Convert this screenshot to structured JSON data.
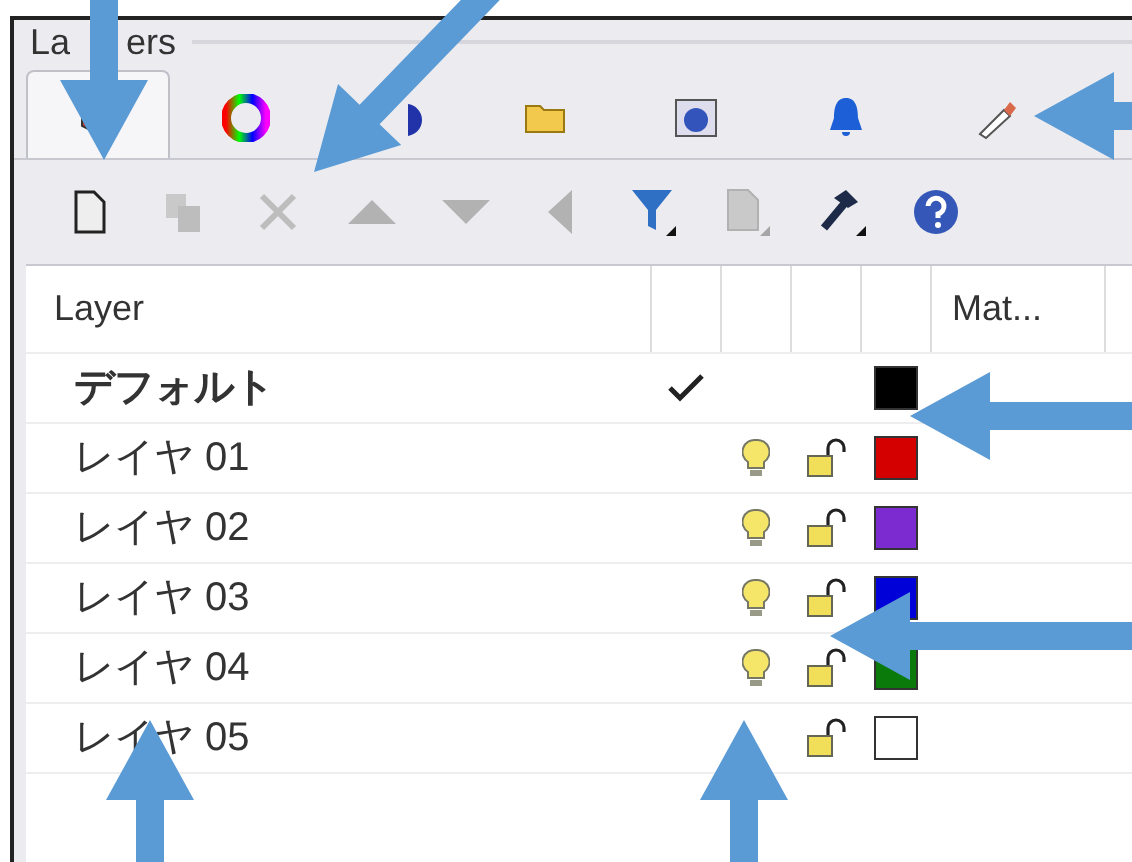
{
  "panel": {
    "title_parts": [
      "La",
      "ers"
    ]
  },
  "tabs": [
    {
      "selected": true
    },
    {
      "selected": false
    },
    {
      "selected": false
    },
    {
      "selected": false
    },
    {
      "selected": false
    },
    {
      "selected": false
    },
    {
      "selected": false
    }
  ],
  "toolbar": [
    {
      "disabled": false
    },
    {
      "disabled": true
    },
    {
      "disabled": true
    },
    {
      "disabled": true
    },
    {
      "disabled": true
    },
    {
      "disabled": true
    },
    {
      "disabled": false
    },
    {
      "disabled": true
    },
    {
      "disabled": false
    },
    {
      "disabled": false
    }
  ],
  "header": {
    "name_column": "Layer",
    "material_column": "Mat..."
  },
  "layers": [
    {
      "name": "デフォルト",
      "current": true,
      "bulb": false,
      "padlock": false,
      "color": "#000000"
    },
    {
      "name": "レイヤ 01",
      "current": false,
      "bulb": true,
      "padlock": true,
      "color": "#d40000"
    },
    {
      "name": "レイヤ 02",
      "current": false,
      "bulb": true,
      "padlock": true,
      "color": "#7b2bd0"
    },
    {
      "name": "レイヤ 03",
      "current": false,
      "bulb": true,
      "padlock": true,
      "color": "#0000d8"
    },
    {
      "name": "レイヤ 04",
      "current": false,
      "bulb": true,
      "padlock": true,
      "color": "#0a7a0a"
    },
    {
      "name": "レイヤ 05",
      "current": false,
      "bulb": false,
      "padlock": true,
      "color": "#ffffff"
    }
  ]
}
